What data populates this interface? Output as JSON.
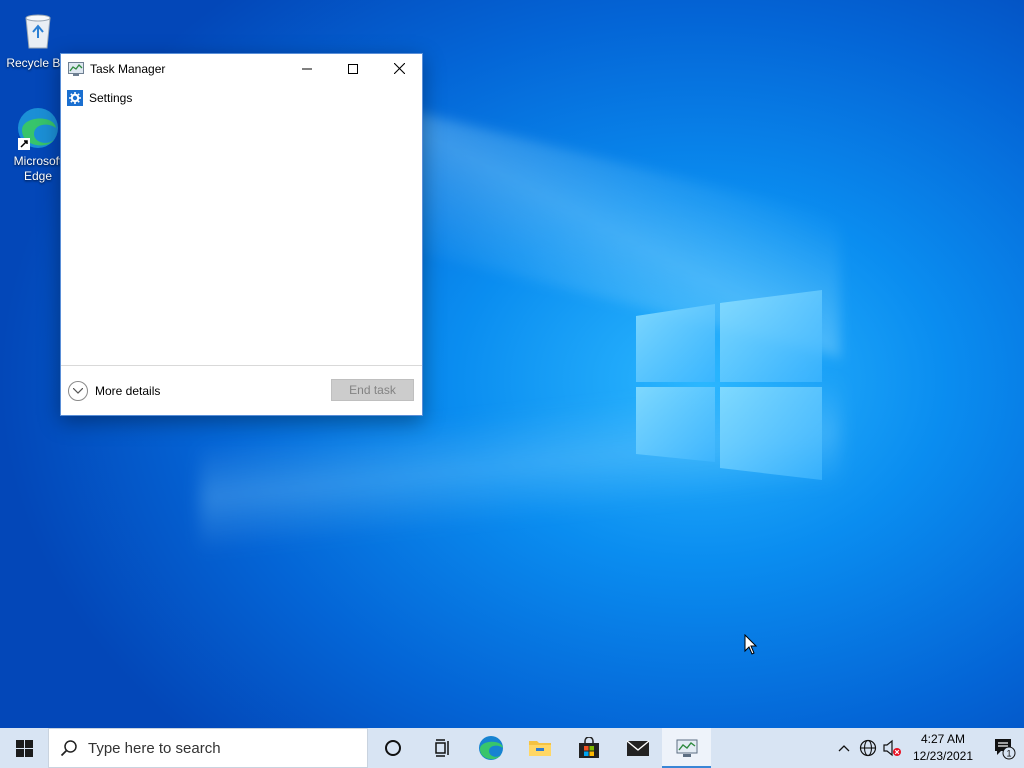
{
  "desktop": {
    "icons": [
      {
        "label": "Recycle Bin",
        "icon": "recycle-bin-icon"
      },
      {
        "label": "Microsoft Edge",
        "icon": "edge-icon"
      }
    ]
  },
  "task_manager": {
    "title": "Task Manager",
    "processes": [
      {
        "label": "Settings",
        "icon": "settings-gear-icon"
      }
    ],
    "more_details_label": "More details",
    "end_task_label": "End task",
    "end_task_enabled": false
  },
  "taskbar": {
    "search_placeholder": "Type here to search",
    "pinned": [
      "cortana-icon",
      "task-view-icon",
      "edge-icon",
      "file-explorer-icon",
      "microsoft-store-icon",
      "mail-icon",
      "task-manager-icon"
    ],
    "active_app": "task-manager-icon",
    "tray": {
      "time": "4:27 AM",
      "date": "12/23/2021",
      "notification_count": "1"
    }
  },
  "colors": {
    "accent": "#3a86d6",
    "taskbar_bg": "#d8e4f3",
    "wallpaper_blue": "#0a8df0"
  }
}
